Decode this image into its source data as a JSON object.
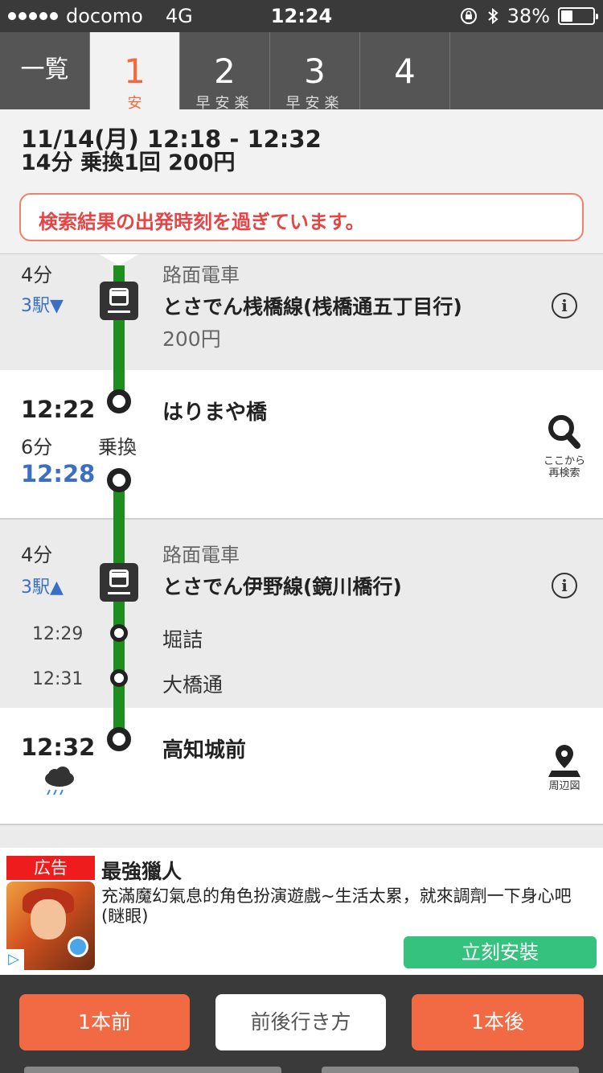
{
  "status_bar": {
    "carrier": "docomo",
    "network": "4G",
    "time": "12:24",
    "battery": "38%",
    "battery_level": 0.38
  },
  "tabs": [
    {
      "num": "一覧",
      "sub": ""
    },
    {
      "num": "1",
      "sub": "安"
    },
    {
      "num": "2",
      "sub": "早安楽"
    },
    {
      "num": "3",
      "sub": "早安楽"
    },
    {
      "num": "4",
      "sub": ""
    }
  ],
  "summary": {
    "line1": "11/14(月) 12:18 - 12:32",
    "line2": "14分 乗換1回 200円",
    "warning": "検索結果の出発時刻を過ぎています。"
  },
  "legs": [
    {
      "duration": "4分",
      "stations": "3駅▼",
      "type": "路面電車",
      "line": "とさでん桟橋線(桟橋通五丁目行)",
      "fare": "200円"
    },
    {
      "duration": "4分",
      "stations": "3駅▲",
      "type": "路面電車",
      "line": "とさでん伊野線(鏡川橋行)",
      "stops": [
        {
          "time": "12:29",
          "name": "堀詰"
        },
        {
          "time": "12:31",
          "name": "大橋通"
        }
      ]
    }
  ],
  "transfer": {
    "arrive_time": "12:22",
    "station": "はりまや橋",
    "wait": "6分",
    "label": "乗換",
    "depart_time": "12:28",
    "search_label_1": "ここから",
    "search_label_2": "再検索"
  },
  "destination": {
    "time": "12:32",
    "station": "高知城前",
    "map_label": "周辺図"
  },
  "ad": {
    "label": "広告",
    "title": "最強獵人",
    "description": "充滿魔幻氣息的角色扮演遊戲~生活太累，就來調劑一下身心吧(瞇眼)",
    "button": "立刻安裝"
  },
  "bottom_bar": {
    "prev": "1本前",
    "middle": "前後行き方",
    "next": "1本後"
  },
  "colors": {
    "accent": "#f26a43",
    "route_line": "#1e8e1e",
    "link_blue": "#3a6fc4",
    "ad_button": "#35c27e"
  }
}
